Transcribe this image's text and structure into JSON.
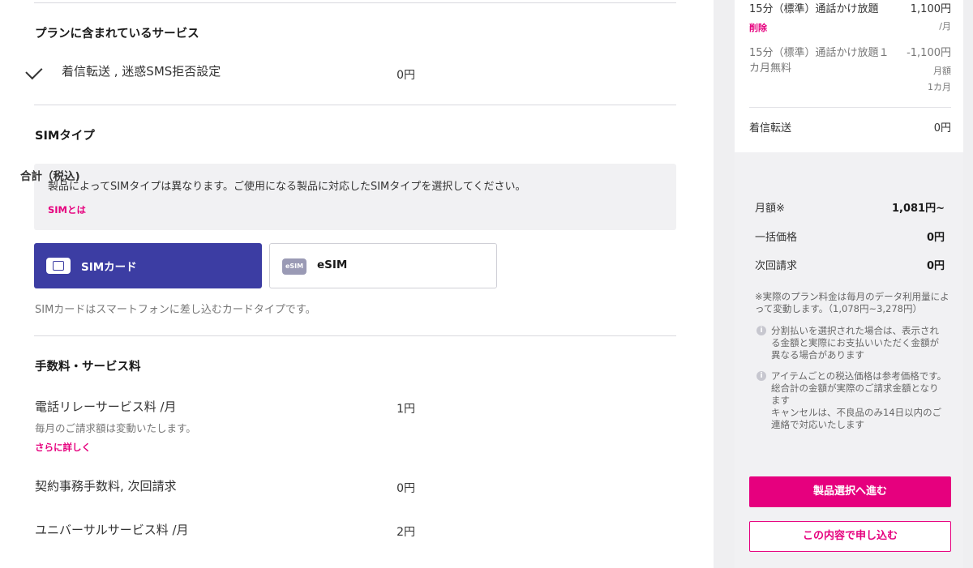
{
  "services": {
    "title": "プランに含まれているサービス",
    "item": "着信転送 , 迷惑SMS拒否設定",
    "price": "0円"
  },
  "sim_type": {
    "title": "SIMタイプ",
    "info": "製品によってSIMタイプは異なります。ご使用になる製品に対応したSIMタイプを選択してください。",
    "info_link": "SIMとは",
    "options": [
      {
        "label": "SIMカード",
        "icon": "sim-card-icon",
        "selected": true
      },
      {
        "label": "eSIM",
        "icon": "esim-icon",
        "icon_text": "eSIM",
        "selected": false
      }
    ],
    "description": "SIMカードはスマートフォンに差し込むカードタイプです。"
  },
  "fees": {
    "title": "手数料・サービス料",
    "items": [
      {
        "label": "電話リレーサービス料 /月",
        "price": "1円",
        "note": "毎月のご請求額は変動いたします。",
        "link": "さらに詳しく"
      },
      {
        "label": "契約事務手数料, 次回請求",
        "price": "0円"
      },
      {
        "label": "ユニバーサルサービス料 /月",
        "price": "2円"
      }
    ]
  },
  "summary": {
    "items": [
      {
        "name": "15分（標準）通話かけ放題",
        "price": "1,100円",
        "unit": "/月",
        "action": "削除"
      },
      {
        "name_line1": "15分（標準）通話かけ放題１",
        "name_line2": "カ月無料",
        "price": "-1,100円",
        "unit1": "月額",
        "unit2": "1カ月"
      },
      {
        "name": "着信転送",
        "price": "0円"
      }
    ],
    "total_title": "合計（税込)",
    "monthly_label": "月額※",
    "monthly_value": "1,081円~",
    "lump_label": "一括価格",
    "lump_value": "0円",
    "next_label": "次回請求",
    "next_value": "0円",
    "note": "※実際のプラン料金は毎月のデータ利用量によって変動します。（1,078円~3,278円）",
    "info1": "分割払いを選択された場合は、表示される金額と実際にお支払いいただく金額が異なる場合があります",
    "info2": "アイテムごとの税込価格は参考価格です。総合計の金額が実際のご請求金額となります\nキャンセルは、不良品のみ14日以内のご連絡で対応いたします",
    "primary_button": "製品選択へ進む",
    "secondary_button": "この内容で申し込む"
  },
  "colors": {
    "accent": "#e6007e",
    "selected": "#3c3da3"
  }
}
